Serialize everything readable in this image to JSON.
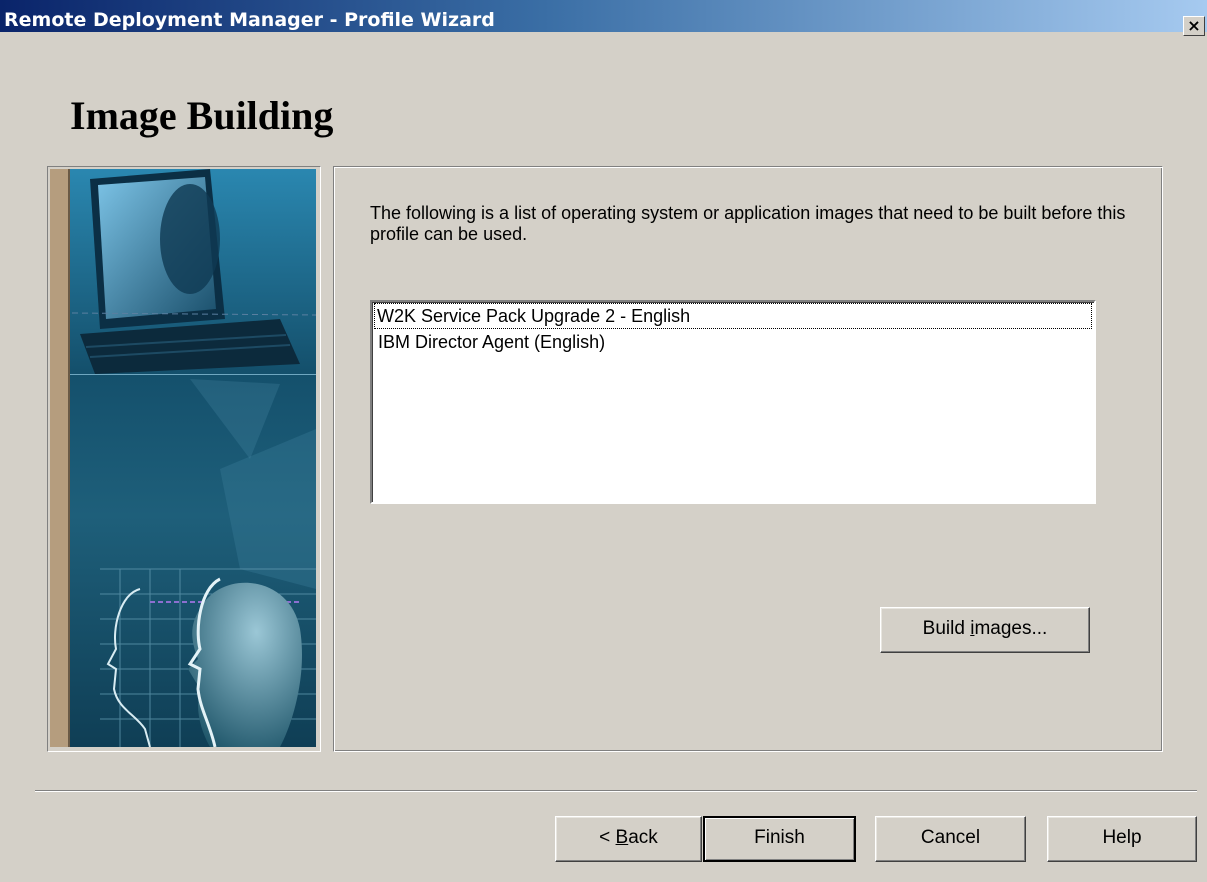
{
  "window": {
    "title": "Remote Deployment Manager - Profile Wizard",
    "close_label": "×"
  },
  "page": {
    "heading": "Image Building",
    "description": "The following is a list of operating system or application images that need to be built before this profile can be used."
  },
  "images_list": {
    "items": [
      "W2K Service Pack Upgrade 2 - English",
      "IBM Director Agent (English)"
    ]
  },
  "buttons": {
    "build_images": {
      "pre": "Build ",
      "accel": "i",
      "post": "mages..."
    },
    "back": {
      "pre": "< ",
      "accel": "B",
      "post": "ack"
    },
    "finish": "Finish",
    "cancel": "Cancel",
    "help": "Help"
  },
  "colors": {
    "titlebar_start": "#0a246a",
    "titlebar_end": "#a6caf0",
    "dialog_bg": "#d4d0c8",
    "artwork_teal": "#1e5f7a"
  }
}
